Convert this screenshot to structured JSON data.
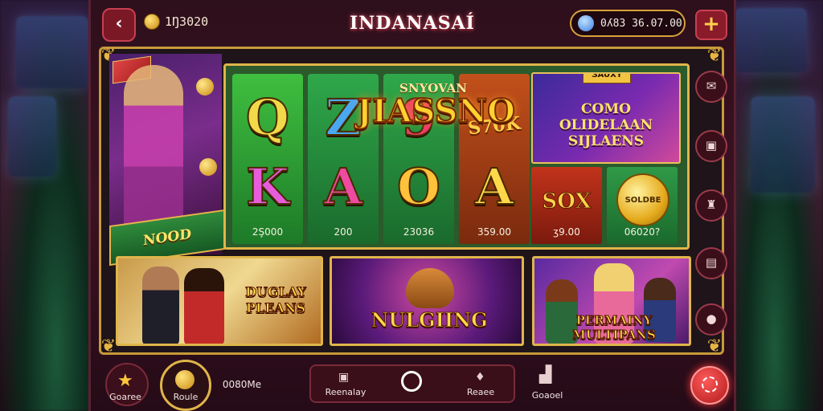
{
  "header": {
    "title": "INDANASAÍ",
    "coins": "1Ŋ3020",
    "balance": "0ʎ83 36.07.00",
    "back_icon": "back-arrow-icon",
    "add_icon": "plus-icon"
  },
  "logo": {
    "subtitle": "SNYOVAN",
    "main": "JIASSNO"
  },
  "hero": {
    "banner": "NOOD"
  },
  "slots": [
    {
      "symbol_top": "Q",
      "symbol_bottom": "K",
      "amount": "2Ş000",
      "top_color": "#f2d94a",
      "bottom_color": "#e85cdc"
    },
    {
      "symbol_top": "Z",
      "symbol_bottom": "A",
      "amount": "200",
      "top_color": "#4aa8f0",
      "bottom_color": "#ee4aa0"
    },
    {
      "symbol_top": "9",
      "symbol_bottom": "O",
      "amount": "23036",
      "top_color": "#ee3a6a",
      "bottom_color": "#ffc23a"
    },
    {
      "symbol_top": "S70K",
      "symbol_bottom": "A",
      "amount": "359.00",
      "top_color": "#ffc23a",
      "bottom_color": "#ffd84a"
    }
  ],
  "promo": {
    "tag": "ƷAUXY",
    "title": "COMO OLIDELAAN SIJLAENS"
  },
  "sox": {
    "label": "SOX",
    "amount": "ʒ9.00"
  },
  "bonus": {
    "coin_label": "SOLDBE",
    "amount": "06020?"
  },
  "games": [
    {
      "title": "DUGLAY PLEANS"
    },
    {
      "title": "NULGIING"
    },
    {
      "title": "PERMAINY MULTIPANS"
    }
  ],
  "sidebar_icons": [
    "chat-icon",
    "gift-icon",
    "trophy-icon",
    "calendar-icon",
    "settings-icon"
  ],
  "bottom_nav": {
    "favorites": "Goaree",
    "home": "Roule",
    "home_value": "0080Me",
    "history": "Reenalay",
    "center_icon": "spin-icon",
    "rewards": "Reaee",
    "events": "Goaoel",
    "fab_icon": "casino-chip-icon"
  },
  "colors": {
    "accent_gold": "#e0b54a",
    "primary_red": "#8a1b2a",
    "panel_green": "#2b5a2b"
  }
}
